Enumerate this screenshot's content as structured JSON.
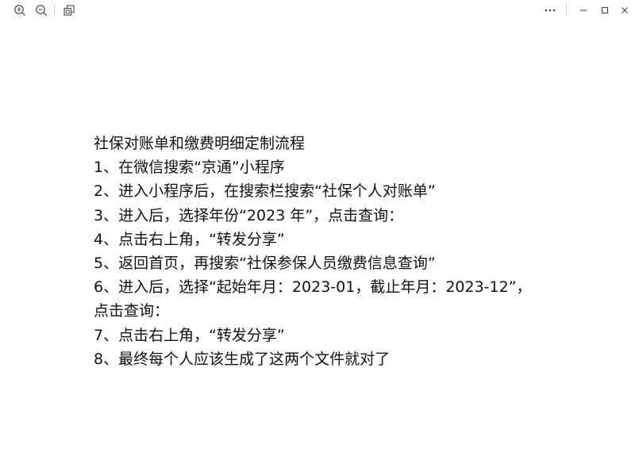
{
  "toolbar": {
    "left_icons": [
      "zoom-in-icon",
      "zoom-out-icon",
      "fit-window-icon"
    ],
    "right_icons": [
      "more-icon",
      "minimize-icon",
      "maximize-icon",
      "close-icon"
    ]
  },
  "document": {
    "title": "社保对账单和缴费明细定制流程",
    "lines": [
      "1、在微信搜索“京通”小程序",
      "2、进入小程序后，在搜索栏搜索“社保个人对账单”",
      "3、进入后，选择年份“2023 年”，点击查询：",
      "4、点击右上角，“转发分享”",
      "5、返回首页，再搜索“社保参保人员缴费信息查询”",
      "6、进入后，选择“起始年月：2023-01，截止年月：2023-12”，点击查询：",
      "7、点击右上角，“转发分享”",
      "8、最终每个人应该生成了这两个文件就对了"
    ]
  },
  "colors": {
    "text": "#111111",
    "icon": "#555555",
    "background": "#ffffff"
  }
}
